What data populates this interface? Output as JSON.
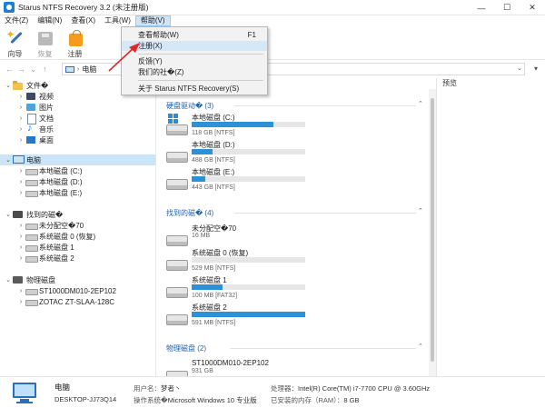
{
  "window": {
    "title": "Starus NTFS Recovery 3.2 (未注册版)",
    "minimize": "—",
    "maximize": "☐",
    "close": "✕"
  },
  "menubar": {
    "items": [
      "文件(Z)",
      "编辑(N)",
      "查看(X)",
      "工具(W)",
      "帮助(V)"
    ]
  },
  "toolbar": {
    "wizard": "向导",
    "restore": "恢复",
    "register": "注册"
  },
  "address": {
    "path": "电脑",
    "back": "←",
    "forward": "→",
    "dropdown": "⌄",
    "up": "↑"
  },
  "view_menu": "▾",
  "preview": {
    "title": "预览"
  },
  "help_menu": {
    "items": [
      {
        "label": "查看帮助(W)",
        "shortcut": "F1"
      },
      {
        "label": "注册(X)",
        "shortcut": ""
      },
      {
        "label": "反馈(Y)",
        "shortcut": ""
      },
      {
        "label": "我们的社�(Z)",
        "shortcut": ""
      },
      {
        "label": "关于 Starus NTFS Recovery(S)",
        "shortcut": ""
      }
    ]
  },
  "tree": {
    "files": {
      "label": "文件�",
      "children": [
        "视频",
        "图片",
        "文档",
        "音乐",
        "桌面"
      ]
    },
    "computer": {
      "label": "电脑",
      "children": [
        "本地磁盘 (C:)",
        "本地磁盘 (D:)",
        "本地磁盘 (E:)"
      ]
    },
    "found": {
      "label": "找到的磁�",
      "children": [
        "未分配空�70",
        "系统磁盘 0 (恢复)",
        "系统磁盘 1",
        "系统磁盘 2"
      ]
    },
    "physical": {
      "label": "物理磁盘",
      "children": [
        "ST1000DM010-2EP102",
        "ZOTAC ZT-SLAA-128C"
      ]
    }
  },
  "content": {
    "groups": [
      {
        "title": "硬盘驱动� (3)",
        "drives": [
          {
            "name": "本地磁盘 (C:)",
            "info": "118 GB [NTFS]",
            "fill": 0.72,
            "windows": true
          },
          {
            "name": "本地磁盘 (D:)",
            "info": "488 GB [NTFS]",
            "fill": 0.18,
            "windows": false
          },
          {
            "name": "本地磁盘 (E:)",
            "info": "443 GB [NTFS]",
            "fill": 0.12,
            "windows": false
          }
        ]
      },
      {
        "title": "找到的磁� (4)",
        "drives": [
          {
            "name": "未分配空�70",
            "info": "16 MB",
            "fill": null,
            "windows": false
          },
          {
            "name": "系统磁盘 0 (恢复)",
            "info": "529 MB [NTFS]",
            "fill": 0.0,
            "windows": false
          },
          {
            "name": "系统磁盘 1",
            "info": "100 MB [FAT32]",
            "fill": 0.27,
            "windows": false
          },
          {
            "name": "系统磁盘 2",
            "info": "591 MB [NTFS]",
            "fill": 1.0,
            "windows": false
          }
        ]
      },
      {
        "title": "物理磁盘 (2)",
        "drives": [
          {
            "name": "ST1000DM010-2EP102",
            "info": "931 GB",
            "fill": null,
            "windows": false
          }
        ]
      }
    ]
  },
  "status": {
    "name": "电脑",
    "host": "DESKTOP-JJ73Q14",
    "user_label": "用户名：",
    "user_value": "梦者丶",
    "os_label": "操作系统�",
    "os_value": "Microsoft Windows 10 专业版",
    "cpu_label": "处理器：",
    "cpu_value": "Intel(R) Core(TM) i7-7700 CPU @ 3.60GHz",
    "ram_label": "已安装的内存（RAM）：",
    "ram_value": "8 GB"
  },
  "colors": {
    "accent": "#2b92d9",
    "link": "#1f5fa8",
    "arrow": "#e0262b"
  }
}
